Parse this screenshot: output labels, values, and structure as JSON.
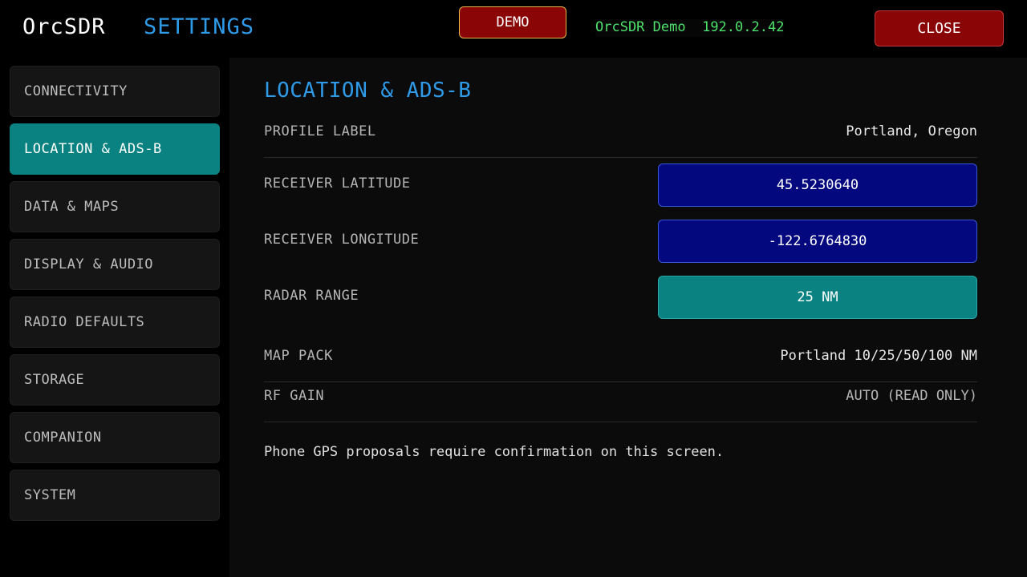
{
  "header": {
    "app_title": "OrcSDR",
    "section_title": "SETTINGS",
    "demo_label": "DEMO",
    "device_name": "OrcSDR Demo",
    "device_ip": "192.0.2.42",
    "close_label": "CLOSE"
  },
  "sidebar": {
    "items": [
      {
        "label": "CONNECTIVITY",
        "active": false
      },
      {
        "label": "LOCATION & ADS-B",
        "active": true
      },
      {
        "label": "DATA & MAPS",
        "active": false
      },
      {
        "label": "DISPLAY & AUDIO",
        "active": false
      },
      {
        "label": "RADIO DEFAULTS",
        "active": false
      },
      {
        "label": "STORAGE",
        "active": false
      },
      {
        "label": "COMPANION",
        "active": false
      },
      {
        "label": "SYSTEM",
        "active": false
      }
    ]
  },
  "panel": {
    "title": "LOCATION & ADS-B",
    "profile_label": {
      "label": "PROFILE LABEL",
      "value": "Portland, Oregon"
    },
    "latitude": {
      "label": "RECEIVER LATITUDE",
      "value": "45.5230640"
    },
    "longitude": {
      "label": "RECEIVER LONGITUDE",
      "value": "-122.6764830"
    },
    "radar_range": {
      "label": "RADAR RANGE",
      "value": "25 NM"
    },
    "map_pack": {
      "label": "MAP PACK",
      "value": "Portland 10/25/50/100 NM"
    },
    "rf_gain": {
      "label": "RF GAIN",
      "value": "AUTO (READ ONLY)"
    },
    "note": "Phone GPS proposals require confirmation on this screen."
  },
  "colors": {
    "accent_blue": "#2f9be8",
    "active_teal": "#0b8282",
    "input_navy": "#04087e",
    "danger_red": "#8a0606",
    "status_green": "#4ee26a"
  }
}
